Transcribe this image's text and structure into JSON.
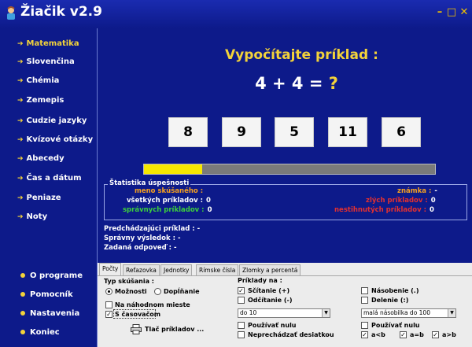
{
  "window": {
    "title": "Žiačik v2.9",
    "minimize": "–",
    "maximize": "□",
    "close": "✕"
  },
  "sidebar": {
    "items": [
      {
        "label": "Matematika",
        "active": true
      },
      {
        "label": "Slovenčina"
      },
      {
        "label": "Chémia"
      },
      {
        "label": "Zemepis"
      },
      {
        "label": "Cudzie jazyky"
      },
      {
        "label": "Kvízové otázky"
      },
      {
        "label": "Abecedy"
      },
      {
        "label": "Čas a dátum"
      },
      {
        "label": "Peniaze"
      },
      {
        "label": "Noty"
      }
    ],
    "bottom_items": [
      {
        "label": "O programe"
      },
      {
        "label": "Pomocník"
      },
      {
        "label": "Nastavenia"
      },
      {
        "label": "Koniec"
      }
    ]
  },
  "exercise": {
    "title": "Vypočítajte príklad :",
    "equation": "4 + 4 =",
    "unknown": "?",
    "answers": [
      "8",
      "9",
      "5",
      "11",
      "6"
    ],
    "progress_fraction": 0.2
  },
  "statistics": {
    "legend": "Štatistika úspešnosti",
    "name_label": "meno skúšaného :",
    "name_value": "",
    "total_label": "všetkých príkladov :",
    "total_value": "0",
    "correct_label": "správnych príkladov :",
    "correct_value": "0",
    "grade_label": "známka :",
    "grade_value": "-",
    "wrong_label": "zlých príkladov :",
    "wrong_value": "0",
    "unsolved_label": "nestihnutých príkladov :",
    "unsolved_value": "0"
  },
  "info": {
    "previous": "Predchádzajúci príklad : -",
    "correct_result": "Správny výsledok : -",
    "given_answer": "Zadaná odpoveď : -"
  },
  "settings": {
    "tabs": [
      "Počty",
      "Reťazovka",
      "Jednotky",
      "Rímske čísla",
      "Zlomky a percentá"
    ],
    "active_tab": "Počty",
    "test_type_label": "Typ skúšania :",
    "options_label": "Možnosti",
    "fill_label": "Dopĺňanie",
    "random_label": "Na náhodnom mieste",
    "timer_label": "S časovačom",
    "print_label": "Tlač príkladov ...",
    "examples_label": "Príklady na :",
    "addition_label": "Sčítanie (+)",
    "subtraction_label": "Odčítanie (-)",
    "multiplication_label": "Násobenie (.)",
    "division_label": "Delenie (:)",
    "range_select": "do 10",
    "multiplication_select": "malá násobilka do 100",
    "use_zero_label": "Používať nulu",
    "no_tens_label": "Neprechádzať desiatkou",
    "use_zero_right_label": "Používať nulu",
    "cmp1": "a<b",
    "cmp2": "a=b",
    "cmp3": "a>b"
  },
  "colors": {
    "panel": "#0d1a8a",
    "accent": "#f3d33a",
    "progress": "#f7e800",
    "stat_orange": "#f5a020",
    "stat_green": "#3ccf3c",
    "stat_red": "#e23030"
  }
}
